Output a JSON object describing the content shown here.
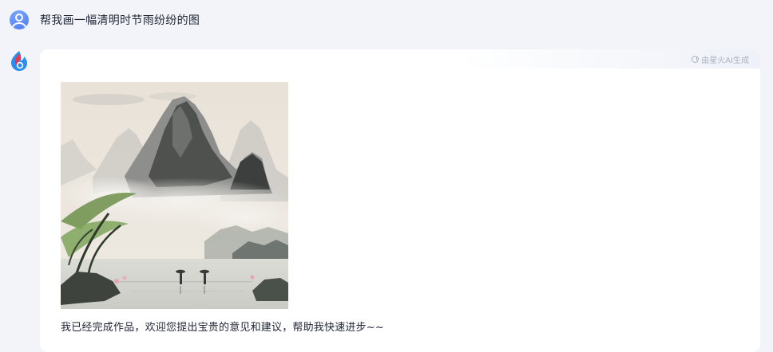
{
  "user_message": {
    "text": "帮我画一幅清明时节雨纷纷的图"
  },
  "answer": {
    "ai_tag": "由星火AI生成",
    "text": "我已经完成作品，欢迎您提出宝贵的意见和建议，帮助我快速进步~~",
    "image": {
      "subject": "ink-wash landscape painting"
    }
  },
  "icons": {
    "user_avatar": "user-avatar-icon",
    "bot_avatar": "spark-logo-icon",
    "ai_tag": "ai-generated-icon"
  },
  "colors": {
    "background": "#f2f4f9",
    "card": "#ffffff",
    "user_avatar": "#5b87f7",
    "muted": "#a9b0bf"
  }
}
